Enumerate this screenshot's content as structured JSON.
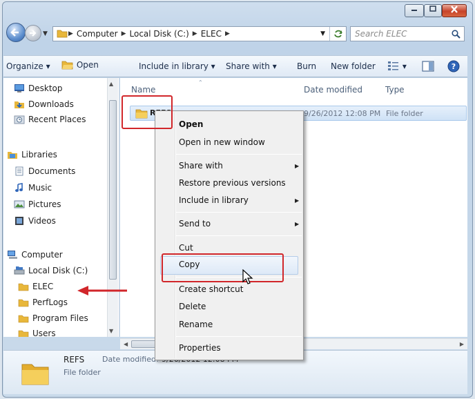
{
  "address_bar": {
    "crumbs": [
      "Computer",
      "Local Disk (C:)",
      "ELEC"
    ]
  },
  "search": {
    "placeholder": "Search ELEC"
  },
  "toolbar": {
    "organize": "Organize",
    "open": "Open",
    "include_in_library": "Include in library",
    "share_with": "Share with",
    "burn": "Burn",
    "new_folder": "New folder"
  },
  "sidebar": {
    "favorites": [
      "Desktop",
      "Downloads",
      "Recent Places"
    ],
    "libraries_label": "Libraries",
    "libraries": [
      "Documents",
      "Music",
      "Pictures",
      "Videos"
    ],
    "computer_label": "Computer",
    "drives": [
      "Local Disk (C:)"
    ],
    "folders": [
      "ELEC",
      "PerfLogs",
      "Program Files",
      "Users"
    ]
  },
  "columns": {
    "name": "Name",
    "date_modified": "Date modified",
    "type": "Type"
  },
  "files": [
    {
      "name": "REFS",
      "date_modified": "9/26/2012 12:08 PM",
      "type": "File folder"
    }
  ],
  "context_menu": {
    "open": "Open",
    "open_new_window": "Open in new window",
    "share_with": "Share with",
    "restore_previous": "Restore previous versions",
    "include_in_library": "Include in library",
    "send_to": "Send to",
    "cut": "Cut",
    "copy": "Copy",
    "create_shortcut": "Create shortcut",
    "delete": "Delete",
    "rename": "Rename",
    "properties": "Properties"
  },
  "details_pane": {
    "name": "REFS",
    "date_label": "Date modified:",
    "date_value": "9/26/2012 12:08 PM",
    "type": "File folder"
  },
  "colors": {
    "annotation": "#d1262a",
    "selection": "#cfe2f6"
  }
}
